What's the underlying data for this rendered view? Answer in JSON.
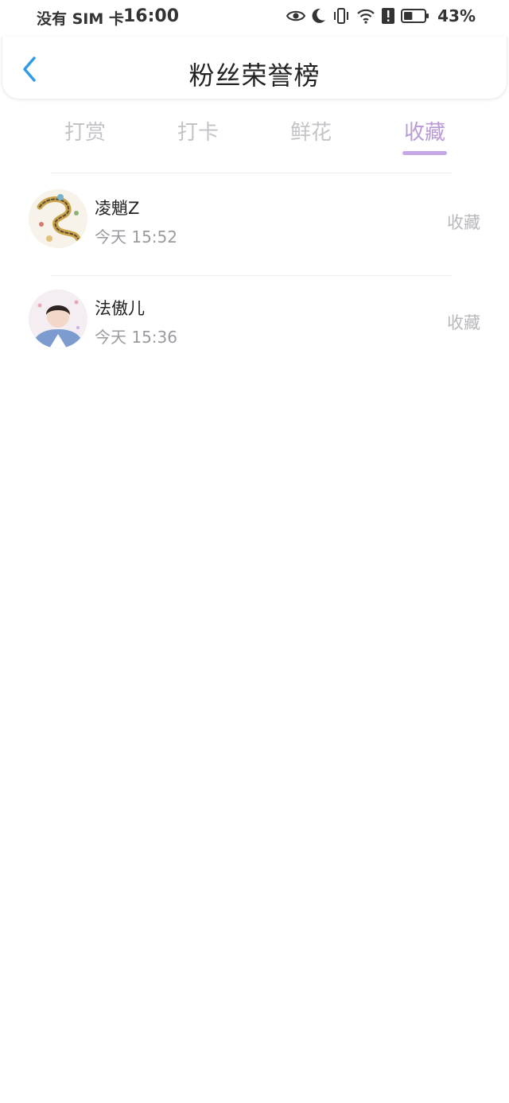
{
  "status_bar": {
    "carrier": "没有 SIM 卡",
    "time": "16:00",
    "battery": "43%",
    "battery_level": 0.43,
    "icons": [
      "eye-icon",
      "moon-icon",
      "vibrate-icon",
      "wifi-icon",
      "alert-icon",
      "battery-icon"
    ]
  },
  "header": {
    "title": "粉丝荣誉榜",
    "back_icon": "chevron-left-icon"
  },
  "tabs": [
    {
      "label": "打赏",
      "active": false
    },
    {
      "label": "打卡",
      "active": false
    },
    {
      "label": "鲜花",
      "active": false
    },
    {
      "label": "收藏",
      "active": true
    }
  ],
  "list": [
    {
      "name": "凌魈Z",
      "time": "今天 15:52",
      "tag": "收藏"
    },
    {
      "name": "法傲儿",
      "time": "今天 15:36",
      "tag": "收藏"
    }
  ],
  "colors": {
    "accent": "#b89bd6",
    "underline": "#c7a8e6",
    "back_icon": "#2f9be8",
    "inactive_tab": "#c4c4c8"
  }
}
